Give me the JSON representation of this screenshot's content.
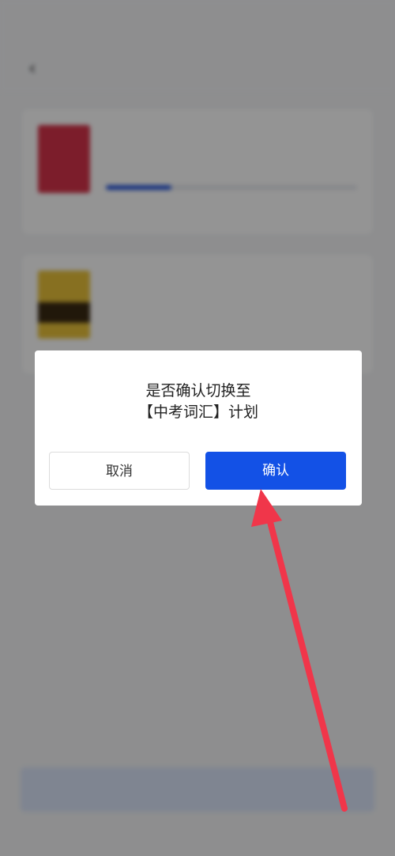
{
  "status_bar": {
    "time": "",
    "icons": ""
  },
  "nav": {
    "back_icon": "chevron-left-icon",
    "title": "",
    "action": ""
  },
  "plans": [
    {
      "title": "",
      "subtitle": "",
      "tag": "",
      "progress": 0.26,
      "foot_left": "",
      "foot_right": "",
      "cover_color": "#d6334a"
    },
    {
      "title": "",
      "subtitle": "",
      "tag": "",
      "cover_color": "#e9c23a"
    }
  ],
  "add_button": {
    "label": ""
  },
  "dialog": {
    "line1": "是否确认切换至",
    "line2": "【中考词汇】计划",
    "cancel_label": "取消",
    "confirm_label": "确认"
  },
  "colors": {
    "primary": "#1351e6",
    "overlay": "rgba(0,0,0,0.42)",
    "annotation_arrow": "#f0364a"
  }
}
